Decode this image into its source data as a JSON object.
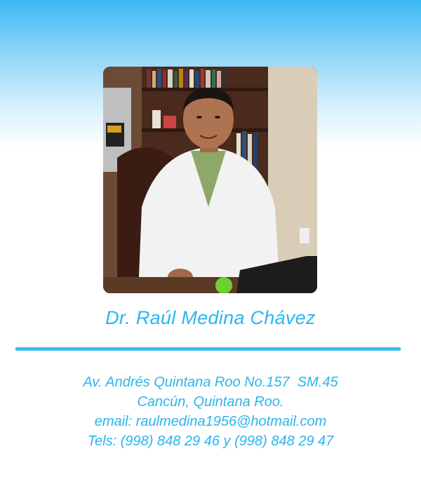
{
  "profile": {
    "name": "Dr. Raúl Medina Chávez",
    "photo_icon": "doctor-portrait",
    "address_line": "Av. Andrés Quintana Roo No.157  SM.45",
    "city_line": "Cancún, Quintana Roo.",
    "email_line": "email: raulmedina1956@hotmail.com",
    "phone_line": "Tels: (998) 848 29 46 y (998) 848 29 47"
  },
  "colors": {
    "accent": "#2bb5ef",
    "gradient_top": "#3ab8f4",
    "background": "#ffffff"
  }
}
